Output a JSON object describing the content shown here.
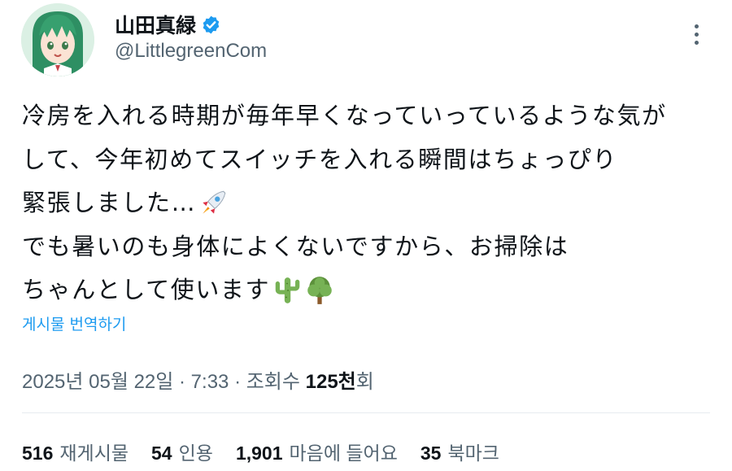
{
  "author": {
    "display_name": "山田真緑",
    "handle": "@LittlegreenCom",
    "verified": true
  },
  "tweet": {
    "lines": [
      "冷房を入れる時期が毎年早くなっていっているような気が",
      "して、今年初めてスイッチを入れる瞬間はちょっぴり",
      "緊張しました…",
      "でも暑いのも身体によくないですから、お掃除は",
      "ちゃんとして使います"
    ],
    "emojis": [
      "rocket-emoji",
      "cactus-emoji",
      "tree-emoji"
    ]
  },
  "translate_label": "게시물 번역하기",
  "meta": {
    "timestamp": "2025년 05월 22일 · 7:33 · 조회수 ",
    "views": "125천",
    "views_suffix": "회"
  },
  "stats": {
    "reposts": {
      "count": "516",
      "label": "재게시물"
    },
    "quotes": {
      "count": "54",
      "label": "인용"
    },
    "likes": {
      "count": "1,901",
      "label": "마음에 들어요"
    },
    "bookmarks": {
      "count": "35",
      "label": "북마크"
    }
  },
  "colors": {
    "link": "#1d9bf0",
    "muted": "#536471",
    "text": "#0f1419",
    "verified": "#1d9bf0"
  }
}
